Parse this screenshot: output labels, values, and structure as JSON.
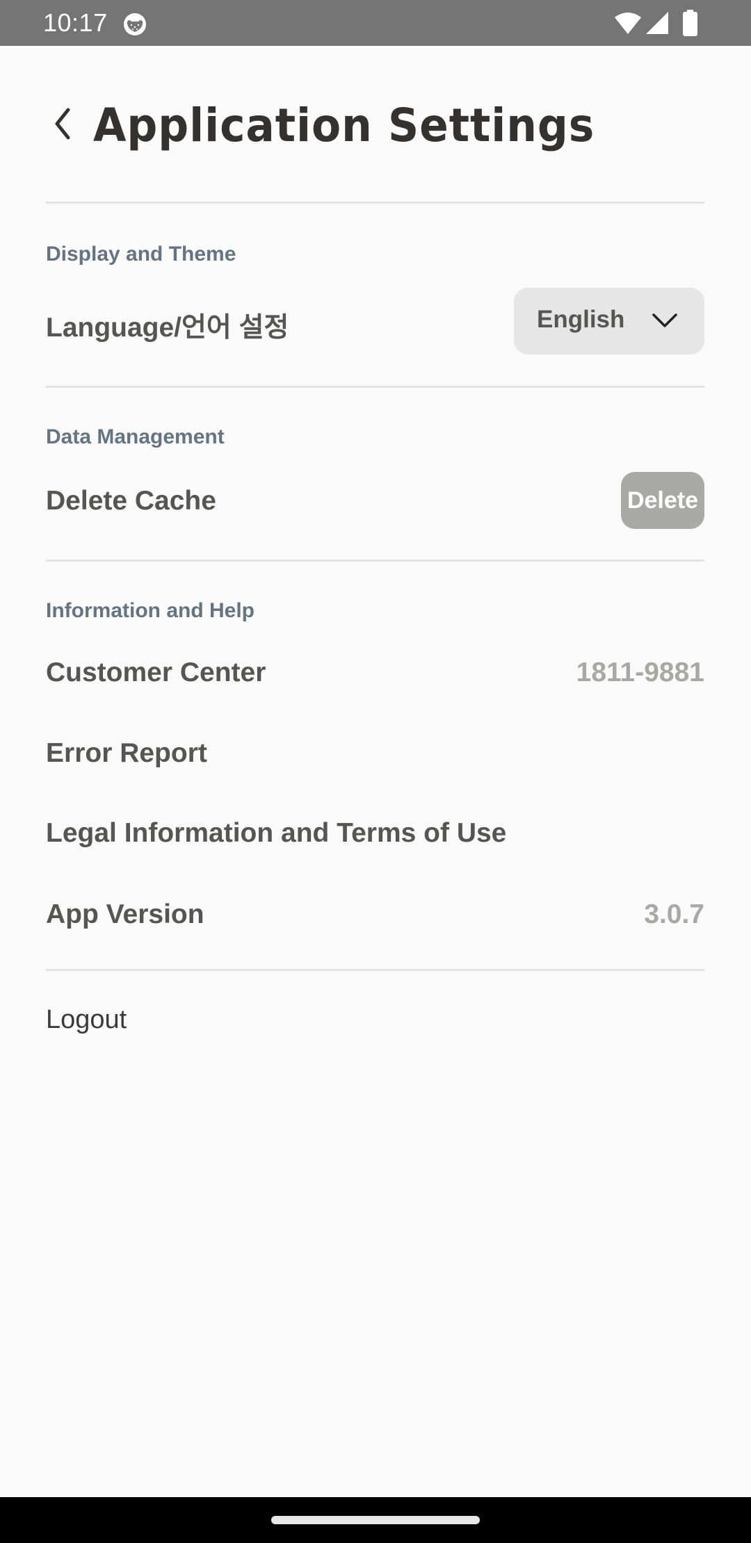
{
  "status_bar": {
    "time": "10:17",
    "icons": [
      "app-notification-icon",
      "wifi-icon",
      "signal-icon",
      "battery-icon"
    ]
  },
  "header": {
    "back_icon": "chevron-left-icon",
    "title": "Application Settings"
  },
  "sections": [
    {
      "label": "Display and Theme",
      "rows": [
        {
          "label": "Language/언어 설정",
          "control": "dropdown",
          "value": "English",
          "icon": "chevron-down-icon"
        }
      ]
    },
    {
      "label": "Data Management",
      "rows": [
        {
          "label": "Delete Cache",
          "control": "button",
          "button_label": "Delete"
        }
      ]
    },
    {
      "label": "Information and Help",
      "rows": [
        {
          "label": "Customer Center",
          "value": "1811-9881"
        },
        {
          "label": "Error Report"
        },
        {
          "label": "Legal Information and Terms of Use"
        },
        {
          "label": "App Version",
          "value": "3.0.7"
        }
      ]
    }
  ],
  "logout_label": "Logout",
  "colors": {
    "status_bar": "#757575",
    "background": "#fafafa",
    "title": "#333230",
    "section_label": "#667482",
    "row_label": "#555554",
    "row_value": "#a8a8a6",
    "dropdown_bg": "#e6e6e6",
    "delete_button_bg": "#a9a9a5",
    "divider": "#e4e4e4"
  }
}
